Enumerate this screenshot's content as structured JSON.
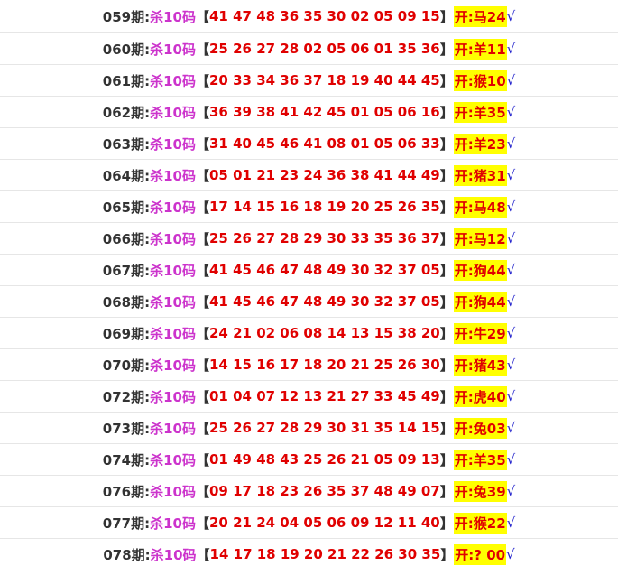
{
  "rows": [
    {
      "period": "059期:",
      "kill": "杀10码",
      "numbers": "41 47 48 36 35 30 02 05 09 15",
      "open": "开:马24",
      "check": "√"
    },
    {
      "period": "060期:",
      "kill": "杀10码",
      "numbers": "25 26 27 28 02 05 06 01 35 36",
      "open": "开:羊11",
      "check": "√"
    },
    {
      "period": "061期:",
      "kill": "杀10码",
      "numbers": "20 33 34 36 37 18 19 40 44 45",
      "open": "开:猴10",
      "check": "√"
    },
    {
      "period": "062期:",
      "kill": "杀10码",
      "numbers": "36 39 38 41 42 45 01 05 06 16",
      "open": "开:羊35",
      "check": "√"
    },
    {
      "period": "063期:",
      "kill": "杀10码",
      "numbers": "31 40 45 46 41 08 01 05 06 33",
      "open": "开:羊23",
      "check": "√"
    },
    {
      "period": "064期:",
      "kill": "杀10码",
      "numbers": "05 01 21 23 24 36 38 41 44 49",
      "open": "开:猪31",
      "check": "√"
    },
    {
      "period": "065期:",
      "kill": "杀10码",
      "numbers": "17 14 15 16 18 19 20 25 26 35",
      "open": "开:马48",
      "check": "√"
    },
    {
      "period": "066期:",
      "kill": "杀10码",
      "numbers": "25 26 27 28 29 30 33 35 36 37",
      "open": "开:马12",
      "check": "√"
    },
    {
      "period": "067期:",
      "kill": "杀10码",
      "numbers": "41 45 46 47 48 49 30 32 37 05",
      "open": "开:狗44",
      "check": "√"
    },
    {
      "period": "068期:",
      "kill": "杀10码",
      "numbers": "41 45 46 47 48 49 30 32 37 05",
      "open": "开:狗44",
      "check": "√"
    },
    {
      "period": "069期:",
      "kill": "杀10码",
      "numbers": "24 21 02 06 08 14 13 15 38 20",
      "open": "开:牛29",
      "check": "√"
    },
    {
      "period": "070期:",
      "kill": "杀10码",
      "numbers": "14 15 16 17 18 20 21 25 26 30",
      "open": "开:猪43",
      "check": "√"
    },
    {
      "period": "072期:",
      "kill": "杀10码",
      "numbers": "01 04 07 12 13 21 27 33 45 49",
      "open": "开:虎40",
      "check": "√"
    },
    {
      "period": "073期:",
      "kill": "杀10码",
      "numbers": "25 26 27 28 29 30 31 35 14 15",
      "open": "开:兔03",
      "check": "√"
    },
    {
      "period": "074期:",
      "kill": "杀10码",
      "numbers": "01 49 48 43 25 26 21 05 09 13",
      "open": "开:羊35",
      "check": "√"
    },
    {
      "period": "076期:",
      "kill": "杀10码",
      "numbers": "09 17 18 23 26 35 37 48 49 07",
      "open": "开:兔39",
      "check": "√"
    },
    {
      "period": "077期:",
      "kill": "杀10码",
      "numbers": "20 21 24 04 05 06 09 12 11 40",
      "open": "开:猴22",
      "check": "√"
    },
    {
      "period": "078期:",
      "kill": "杀10码",
      "numbers": "14 17 18 19 20 21 22 26 30 35",
      "open": "开:? 00",
      "check": "√"
    }
  ]
}
